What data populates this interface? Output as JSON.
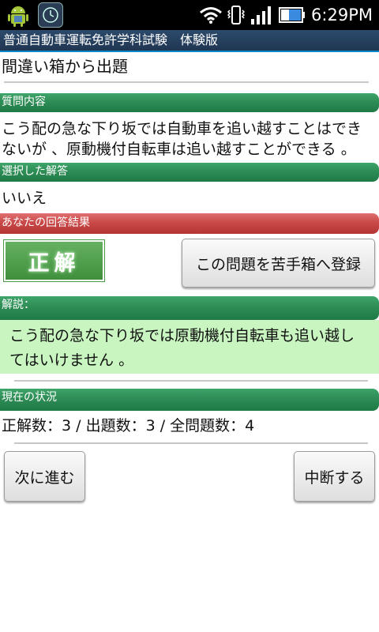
{
  "statusbar": {
    "time": "6:29PM"
  },
  "titlebar": {
    "title": "普通自動車運転免許学科試験　体験版"
  },
  "mode": {
    "heading": "間違い箱から出題"
  },
  "question": {
    "header": "質問内容",
    "line1": "こう配の急な下り坂では自動車を追い越すことはでき",
    "line2": "ないが 、原動機付自転車は追い越すことができる 。"
  },
  "selected": {
    "header": "選択した解答",
    "value": "いいえ"
  },
  "result": {
    "header": "あなたの回答結果",
    "badge": "正解",
    "add_weak_button": "この問題を苦手箱へ登録"
  },
  "explanation": {
    "header": "解説：",
    "line1": "こう配の急な下り坂では原動機付自転車も追い越し",
    "line2": "てはいけません 。"
  },
  "status": {
    "header": "現在の状況",
    "summary": "正解数：3 / 出題数：3 / 全問題数：4"
  },
  "buttons": {
    "next": "次に進む",
    "suspend": "中断する"
  },
  "colors": {
    "section_green": "#2e8c55",
    "section_red": "#c94848",
    "explanation_bg": "#c8f5c0",
    "titlebar_bg": "#2d4a6b"
  }
}
